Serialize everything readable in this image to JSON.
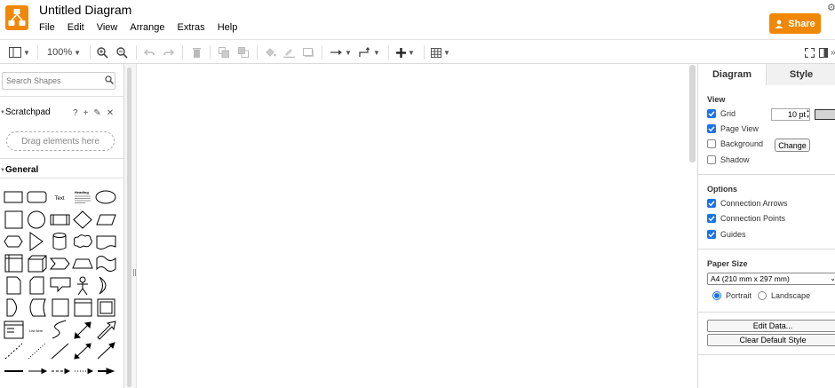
{
  "app": {
    "title": "Untitled Diagram",
    "accent_color": "#f08705",
    "menu": [
      "File",
      "Edit",
      "View",
      "Arrange",
      "Extras",
      "Help"
    ],
    "share_label": "Share"
  },
  "toolbar": {
    "zoom": "100%"
  },
  "sidebar": {
    "search_placeholder": "Search Shapes",
    "scratchpad_title": "Scratchpad",
    "scratchpad_icons": [
      "?",
      "+",
      "✎",
      "✕"
    ],
    "dropzone_label": "Drag elements here",
    "general_title": "General",
    "shape_labels": {
      "text": "Text",
      "heading": "Heading",
      "list_item": "List Item"
    }
  },
  "format_panel": {
    "tabs": [
      "Diagram",
      "Style"
    ],
    "view_title": "View",
    "grid_label": "Grid",
    "grid_size": "10 pt",
    "page_view_label": "Page View",
    "background_label": "Background",
    "change_label": "Change",
    "shadow_label": "Shadow",
    "options_title": "Options",
    "connection_arrows_label": "Connection Arrows",
    "connection_points_label": "Connection Points",
    "guides_label": "Guides",
    "paper_size_title": "Paper Size",
    "paper_size_value": "A4 (210 mm x 297 mm)",
    "portrait_label": "Portrait",
    "landscape_label": "Landscape",
    "edit_data_label": "Edit Data...",
    "clear_default_style_label": "Clear Default Style",
    "checked": {
      "grid": true,
      "page_view": true,
      "background": false,
      "shadow": false,
      "connection_arrows": true,
      "connection_points": true,
      "guides": true
    },
    "orientation": "portrait",
    "checkbox_color": "#1a73e8"
  }
}
